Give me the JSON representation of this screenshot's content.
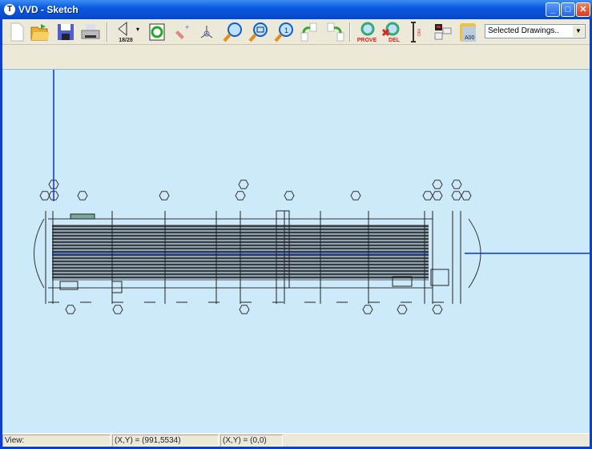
{
  "window": {
    "title": "VVD - Sketch",
    "app_icon": "T"
  },
  "toolbar": {
    "buttons": [
      {
        "name": "new-icon",
        "label": "New"
      },
      {
        "name": "open-icon",
        "label": "Open"
      },
      {
        "name": "save-icon",
        "label": "Save"
      },
      {
        "name": "print-icon",
        "label": "Print"
      },
      {
        "name": "view-icon",
        "label": "18/28"
      },
      {
        "name": "refresh-icon",
        "label": "Refresh"
      },
      {
        "name": "pen-icon",
        "label": "Edit"
      },
      {
        "name": "axis-icon",
        "label": "Axis"
      },
      {
        "name": "zoom-icon",
        "label": "Zoom"
      },
      {
        "name": "zoom-window-icon",
        "label": "Zoom Window"
      },
      {
        "name": "zoom-fit-icon",
        "label": "Zoom 1"
      },
      {
        "name": "copy-left-icon",
        "label": "Copy Left"
      },
      {
        "name": "copy-right-icon",
        "label": "Copy Right"
      },
      {
        "name": "prove-icon",
        "label": "PROVE"
      },
      {
        "name": "del-icon",
        "label": "DEL"
      },
      {
        "name": "dimension-icon",
        "label": "HIO"
      },
      {
        "name": "layout-icon",
        "label": "Layout"
      },
      {
        "name": "a00-icon",
        "label": "A00"
      }
    ],
    "drawing_select": {
      "value": "Selected Drawings.."
    }
  },
  "status": {
    "view_label": "View:",
    "cursor_xy": "(X,Y) = (991,5534)",
    "origin_xy": "(X,Y) = (0,0)"
  },
  "colors": {
    "canvas": "#cdeafb",
    "titlebar": "#0a5ae0",
    "guide": "#3a5ff0"
  }
}
